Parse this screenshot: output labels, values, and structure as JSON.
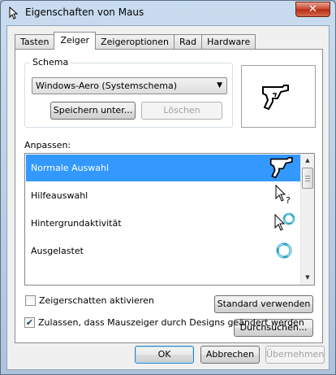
{
  "window": {
    "title": "Eigenschaften von Maus",
    "close_glyph": "✕"
  },
  "tabs": [
    {
      "label": "Tasten",
      "active": false
    },
    {
      "label": "Zeiger",
      "active": true
    },
    {
      "label": "Zeigeroptionen",
      "active": false
    },
    {
      "label": "Rad",
      "active": false
    },
    {
      "label": "Hardware",
      "active": false
    }
  ],
  "scheme": {
    "group_label": "Schema",
    "selected": "Windows-Aero (Systemschema)",
    "save_label": "Speichern unter...",
    "delete_label": "Löschen"
  },
  "preview": {
    "cursor_icon": "handgun-cursor-icon"
  },
  "customize": {
    "label": "Anpassen:",
    "items": [
      {
        "label": "Normale Auswahl",
        "icon": "handgun-cursor-icon",
        "selected": true
      },
      {
        "label": "Hilfeauswahl",
        "icon": "help-select-cursor-icon",
        "selected": false
      },
      {
        "label": "Hintergrundaktivität",
        "icon": "working-in-background-cursor-icon",
        "selected": false
      },
      {
        "label": "Ausgelastet",
        "icon": "busy-cursor-icon",
        "selected": false
      }
    ]
  },
  "options": {
    "shadow_label": "Zeigerschatten aktivieren",
    "shadow_checked": false,
    "default_label": "Standard verwenden",
    "browse_label": "Durchsuchen...",
    "themes_label": "Zulassen, dass Mauszeiger durch Designs geändert werden",
    "themes_checked": true,
    "check_glyph": "✔"
  },
  "footer": {
    "ok_label": "OK",
    "cancel_label": "Abbrechen",
    "apply_label": "Übernehmen"
  },
  "colors": {
    "selection": "#3399ff",
    "close": "#c7452f"
  }
}
